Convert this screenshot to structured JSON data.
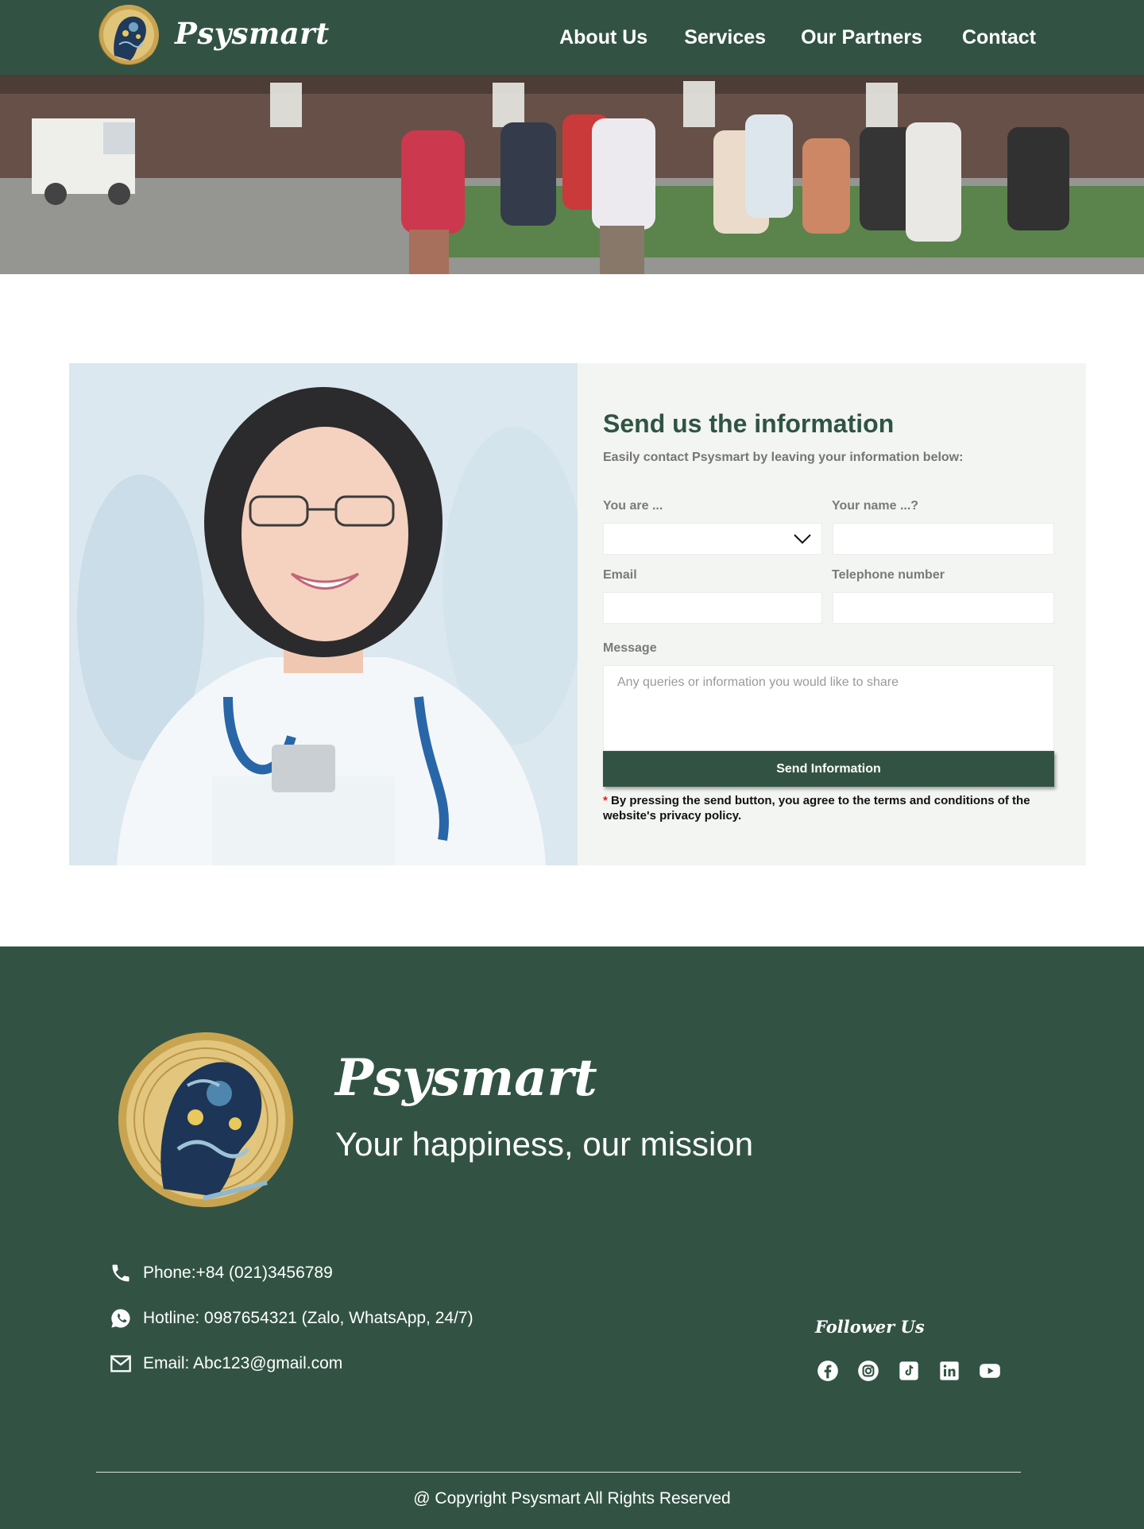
{
  "header": {
    "brand": "Psysmart",
    "nav": [
      "About Us",
      "Services",
      "Our Partners",
      "Contact"
    ]
  },
  "contact_form": {
    "title": "Send us the information",
    "subtitle": "Easily contact Psysmart by leaving your information below:",
    "labels": {
      "you_are": "You are ...",
      "your_name": "Your name ...?",
      "email": "Email",
      "telephone": "Telephone number",
      "message": "Message"
    },
    "values": {
      "you_are": "",
      "your_name": "",
      "email": "",
      "telephone": ""
    },
    "message_placeholder": "Any queries or information you would like to share",
    "send_label": "Send Information",
    "disclaimer_star": "*",
    "disclaimer": " By pressing the send button, you agree to the terms and conditions of the website's privacy policy."
  },
  "footer": {
    "brand": "Psysmart",
    "tagline": "Your happiness, our mission",
    "phone": "Phone:+84 (021)3456789",
    "hotline": "Hotline: 0987654321 (Zalo, WhatsApp, 24/7)",
    "email": "Email: Abc123@gmail.com",
    "follow_label": "Follower Us",
    "socials": [
      "facebook-icon",
      "instagram-icon",
      "tiktok-icon",
      "linkedin-icon",
      "youtube-icon"
    ],
    "copyright": "@ Copyright Psysmart All Rights Reserved"
  },
  "colors": {
    "primary": "#325344",
    "panel_bg": "#f3f5f2",
    "accent_red": "#e02020"
  }
}
